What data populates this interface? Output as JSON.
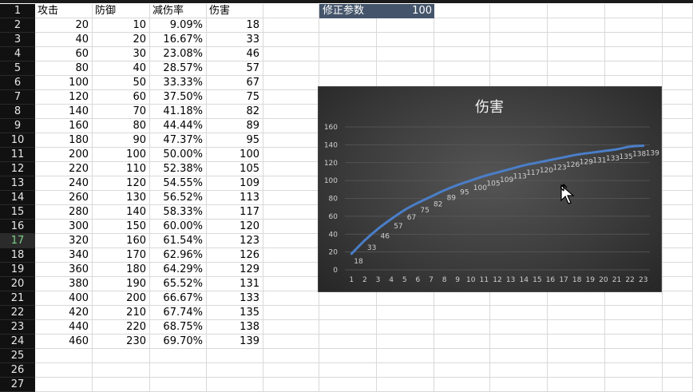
{
  "sheet": {
    "headers": [
      "攻击",
      "防御",
      "减伤率",
      "伤害"
    ],
    "row_numbers": [
      "1",
      "2",
      "3",
      "4",
      "5",
      "6",
      "7",
      "8",
      "9",
      "10",
      "11",
      "12",
      "13",
      "14",
      "15",
      "16",
      "17",
      "18",
      "19",
      "20",
      "21",
      "22",
      "23",
      "24",
      "25",
      "26",
      "27"
    ],
    "selected_row": "17",
    "rows": [
      [
        "20",
        "10",
        "9.09%",
        "18"
      ],
      [
        "40",
        "20",
        "16.67%",
        "33"
      ],
      [
        "60",
        "30",
        "23.08%",
        "46"
      ],
      [
        "80",
        "40",
        "28.57%",
        "57"
      ],
      [
        "100",
        "50",
        "33.33%",
        "67"
      ],
      [
        "120",
        "60",
        "37.50%",
        "75"
      ],
      [
        "140",
        "70",
        "41.18%",
        "82"
      ],
      [
        "160",
        "80",
        "44.44%",
        "89"
      ],
      [
        "180",
        "90",
        "47.37%",
        "95"
      ],
      [
        "200",
        "100",
        "50.00%",
        "100"
      ],
      [
        "220",
        "110",
        "52.38%",
        "105"
      ],
      [
        "240",
        "120",
        "54.55%",
        "109"
      ],
      [
        "260",
        "130",
        "56.52%",
        "113"
      ],
      [
        "280",
        "140",
        "58.33%",
        "117"
      ],
      [
        "300",
        "150",
        "60.00%",
        "120"
      ],
      [
        "320",
        "160",
        "61.54%",
        "123"
      ],
      [
        "340",
        "170",
        "62.96%",
        "126"
      ],
      [
        "360",
        "180",
        "64.29%",
        "129"
      ],
      [
        "380",
        "190",
        "65.52%",
        "131"
      ],
      [
        "400",
        "200",
        "66.67%",
        "133"
      ],
      [
        "420",
        "210",
        "67.74%",
        "135"
      ],
      [
        "440",
        "220",
        "68.75%",
        "138"
      ],
      [
        "460",
        "230",
        "69.70%",
        "139"
      ]
    ]
  },
  "param": {
    "label": "修正参数",
    "value": "100"
  },
  "chart_data": {
    "type": "line",
    "title": "伤害",
    "categories": [
      "1",
      "2",
      "3",
      "4",
      "5",
      "6",
      "7",
      "8",
      "9",
      "10",
      "11",
      "12",
      "13",
      "14",
      "15",
      "16",
      "17",
      "18",
      "19",
      "20",
      "21",
      "22",
      "23"
    ],
    "series": [
      {
        "values": [
          18,
          33,
          46,
          57,
          67,
          75,
          82,
          89,
          95,
          100,
          105,
          109,
          113,
          117,
          120,
          123,
          126,
          129,
          131,
          133,
          135,
          138,
          139
        ]
      }
    ],
    "ylim": [
      0,
      160
    ],
    "yticks": [
      "0",
      "20",
      "40",
      "60",
      "80",
      "100",
      "120",
      "140",
      "160"
    ],
    "grid": true,
    "data_labels": true,
    "line_color": "#4a7ec8"
  }
}
